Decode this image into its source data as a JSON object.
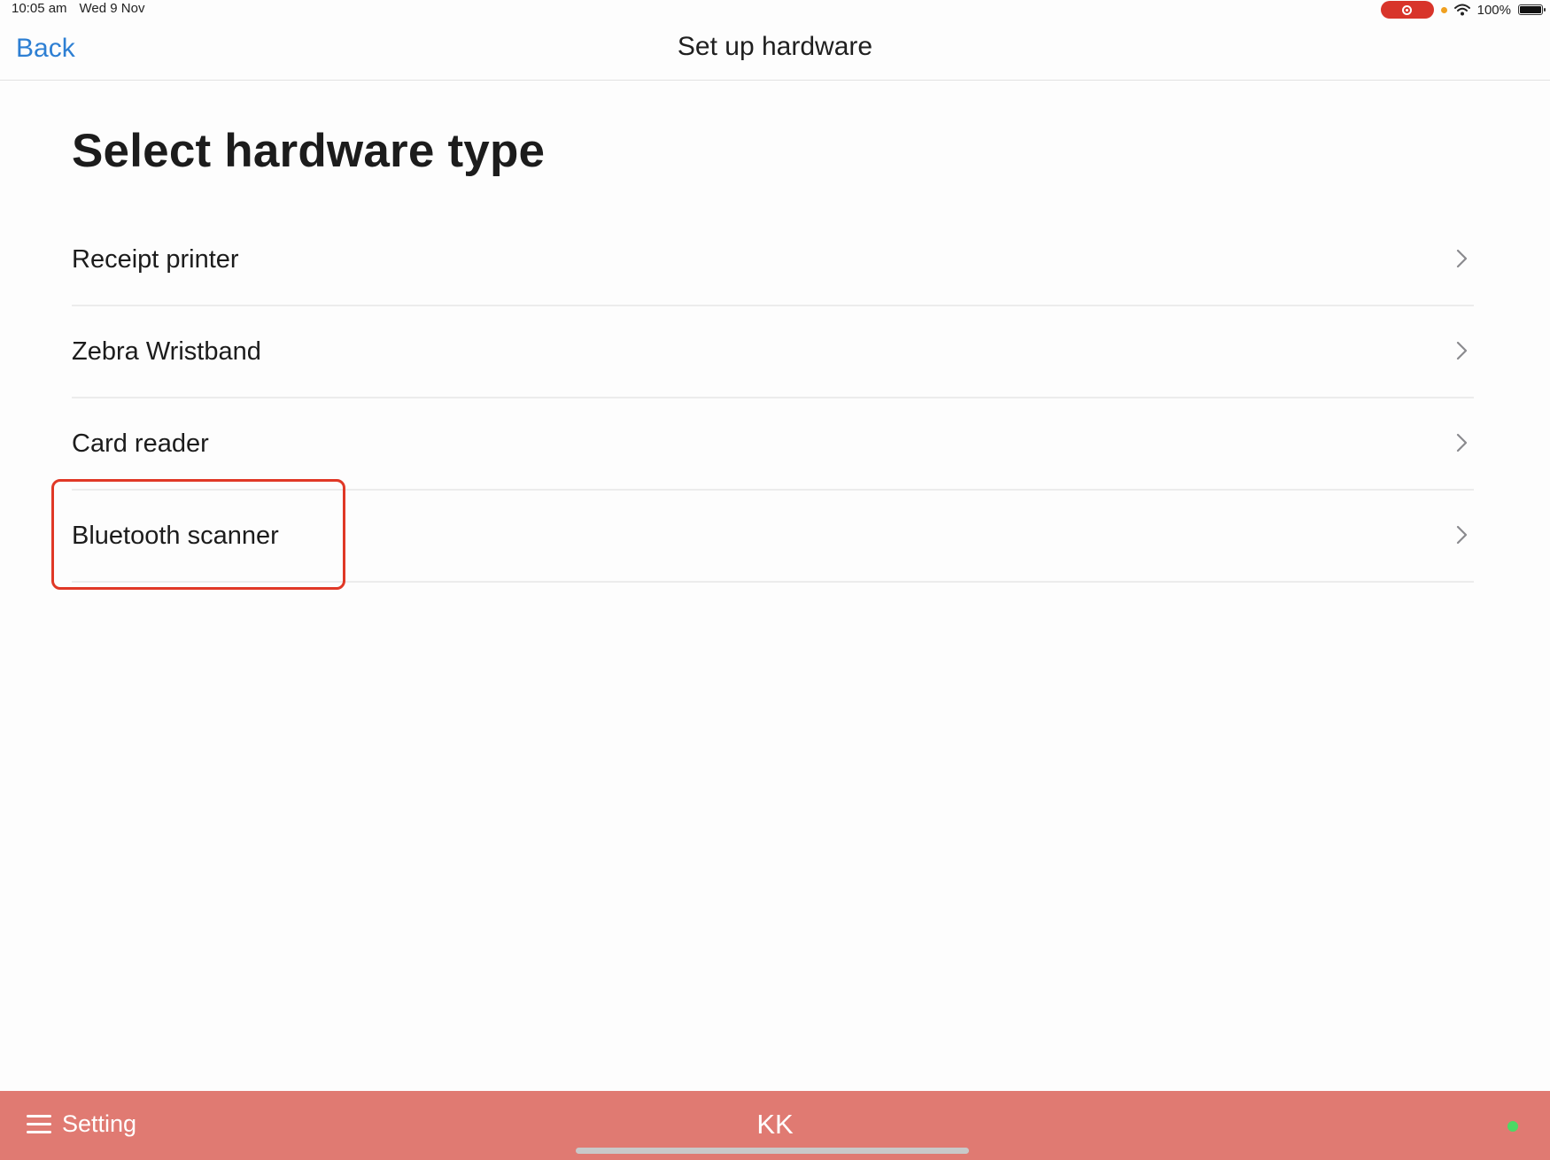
{
  "status_bar": {
    "time": "10:05 am",
    "date": "Wed 9 Nov",
    "battery_text": "100%",
    "battery_level": 1.0,
    "icons": [
      "screen-record-icon",
      "orange-dot-icon",
      "wifi-icon",
      "battery-icon"
    ]
  },
  "nav": {
    "back_label": "Back",
    "title": "Set up hardware"
  },
  "page": {
    "heading": "Select hardware type"
  },
  "hardware_types": [
    {
      "label": "Receipt printer",
      "icon": "chevron-right-icon"
    },
    {
      "label": "Zebra Wristband",
      "icon": "chevron-right-icon"
    },
    {
      "label": "Card reader",
      "icon": "chevron-right-icon"
    },
    {
      "label": "Bluetooth scanner",
      "icon": "chevron-right-icon",
      "highlighted": true
    }
  ],
  "bottom_bar": {
    "menu_label": "Setting",
    "center_text": "KK",
    "status_color": "#4cd964",
    "background_color": "#e07a72"
  },
  "colors": {
    "accent": "#2d7fd3",
    "highlight": "#e03826"
  }
}
